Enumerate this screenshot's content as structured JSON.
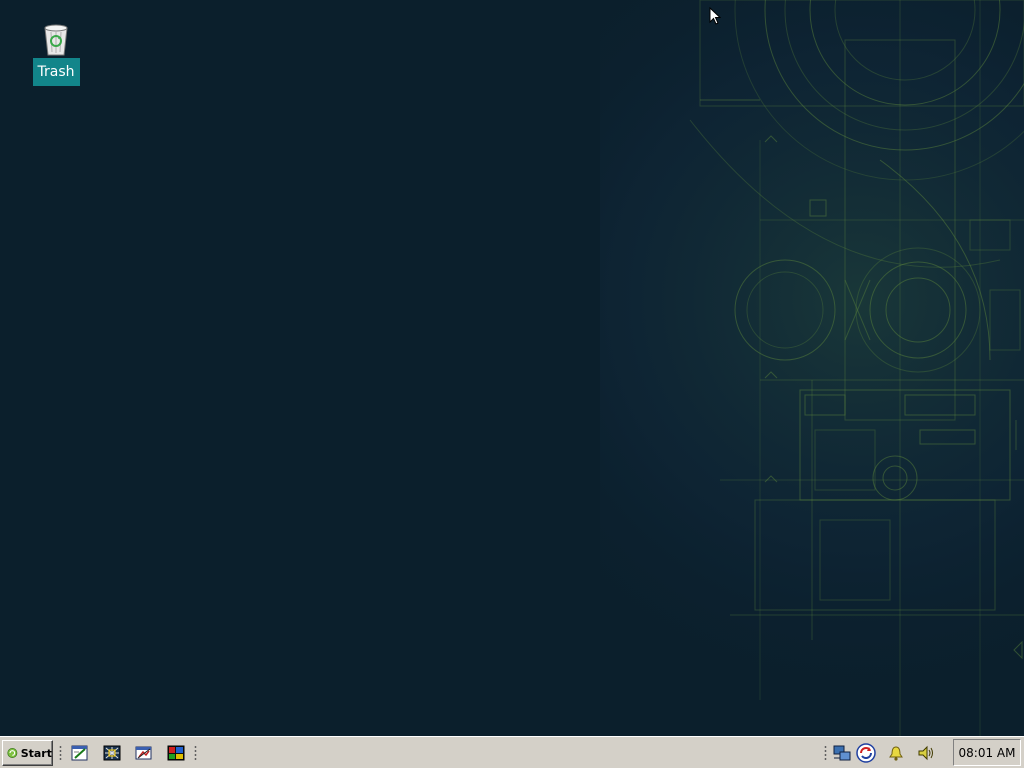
{
  "desktop": {
    "background_color": "#0b1f2c",
    "wallpaper_line_color": "#5f8a3c",
    "icons": [
      {
        "label": "Trash",
        "icon": "trash-icon"
      }
    ]
  },
  "taskbar": {
    "start": {
      "label": "Start",
      "icon": "start-logo-icon"
    },
    "quick_launch": [
      {
        "icon": "text-editor-icon"
      },
      {
        "icon": "network-tool-icon"
      },
      {
        "icon": "file-manager-icon"
      },
      {
        "icon": "terminal-icon"
      }
    ],
    "tray": [
      {
        "icon": "network-icon"
      },
      {
        "icon": "update-icon"
      },
      {
        "icon": "notification-bell-icon"
      },
      {
        "icon": "volume-icon"
      }
    ],
    "clock": "08:01 AM"
  }
}
